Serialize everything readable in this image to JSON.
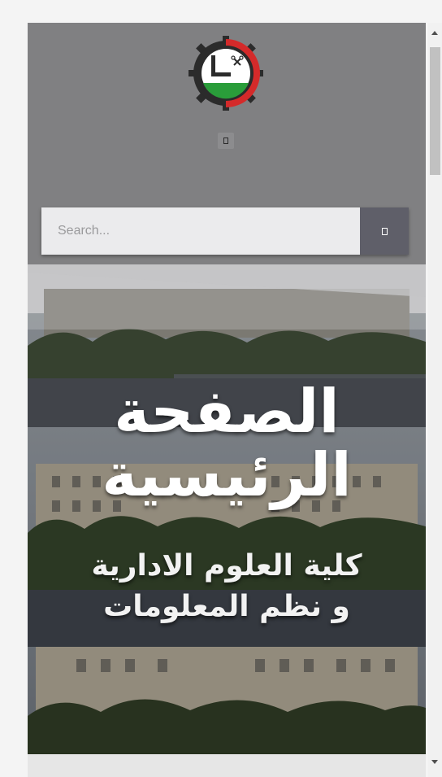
{
  "header": {
    "logo_name": "university-seal-logo",
    "menu_icon": "menu-toggle-icon"
  },
  "search": {
    "placeholder": "Search...",
    "button_icon": "search-icon"
  },
  "hero": {
    "title_line1": "الصفحة",
    "title_line2": "الرئيسية",
    "subtitle_line1": "كلية العلوم الادارية",
    "subtitle_line2": "و نظم المعلومات"
  },
  "colors": {
    "header_bg": "#808082",
    "search_button": "#5f5f69",
    "logo_green": "#2a9d3a",
    "logo_red": "#d42a2a"
  }
}
